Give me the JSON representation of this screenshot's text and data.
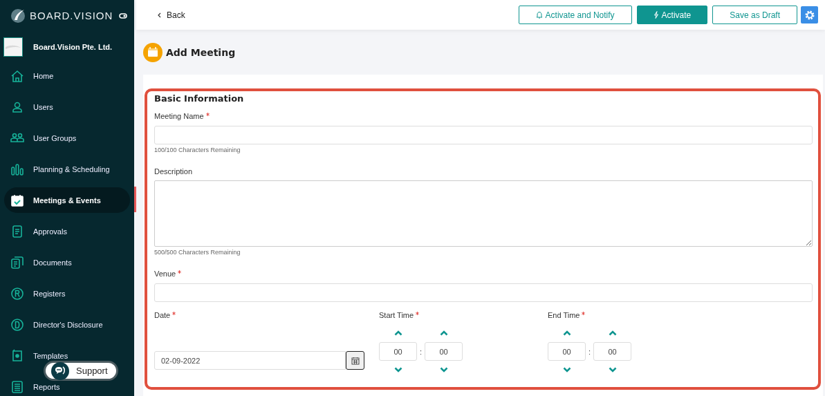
{
  "sidebar": {
    "brand": "BOARD.VISION",
    "company": "Board.Vision Pte. Ltd.",
    "items": [
      {
        "label": "Home",
        "selected": false
      },
      {
        "label": "Users",
        "selected": false
      },
      {
        "label": "User Groups",
        "selected": false
      },
      {
        "label": "Planning & Scheduling",
        "selected": false
      },
      {
        "label": "Meetings & Events",
        "selected": true
      },
      {
        "label": "Approvals",
        "selected": false
      },
      {
        "label": "Documents",
        "selected": false
      },
      {
        "label": "Registers",
        "selected": false
      },
      {
        "label": "Director's Disclosure",
        "selected": false
      },
      {
        "label": "Templates",
        "selected": false
      },
      {
        "label": "Reports",
        "selected": false
      }
    ],
    "support": "Support"
  },
  "topbar": {
    "back": "Back",
    "buttons": [
      {
        "label": "Activate and Notify",
        "kind": "notify"
      },
      {
        "label": "Activate",
        "kind": "primary"
      },
      {
        "label": "Save as Draft",
        "kind": "outline"
      }
    ]
  },
  "page_title": "Add Meeting",
  "form": {
    "section": "Basic Information",
    "meeting_name": {
      "label": "Meeting Name",
      "required": true,
      "hint": "100/100 Characters Remaining"
    },
    "description": {
      "label": "Description",
      "required": false,
      "hint": "500/500 Characters Remaining"
    },
    "venue": {
      "label": "Venue",
      "required": true
    },
    "date": {
      "label": "Date",
      "required": true,
      "value": "02-09-2022"
    },
    "times": [
      {
        "label": "Start Time",
        "required": true,
        "hours": "00",
        "minutes": "00",
        "separator": ":"
      },
      {
        "label": "End Time",
        "required": true,
        "hours": "00",
        "minutes": "00",
        "separator": ":"
      }
    ]
  }
}
